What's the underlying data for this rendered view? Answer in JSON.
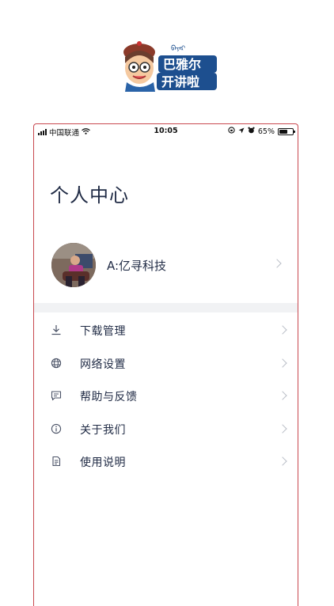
{
  "logo": {
    "line1": "巴雅尔",
    "line2": "开讲啦",
    "script_text": "ᠪᠠᠶᠠᠷ"
  },
  "status_bar": {
    "carrier": "中国联通",
    "time": "10:05",
    "battery": "65%",
    "battery_level": 0.65
  },
  "page": {
    "title": "个人中心"
  },
  "profile": {
    "name": "A:亿寻科技"
  },
  "menu": [
    {
      "label": "下载管理",
      "icon": "download-icon"
    },
    {
      "label": "网络设置",
      "icon": "globe-icon"
    },
    {
      "label": "帮助与反馈",
      "icon": "feedback-icon"
    },
    {
      "label": "关于我们",
      "icon": "info-icon"
    },
    {
      "label": "使用说明",
      "icon": "document-icon"
    }
  ],
  "colors": {
    "frame": "#c8484f",
    "text": "#1f2a44",
    "logo_blue": "#1d4f8f",
    "chevron": "#b9bec7"
  }
}
